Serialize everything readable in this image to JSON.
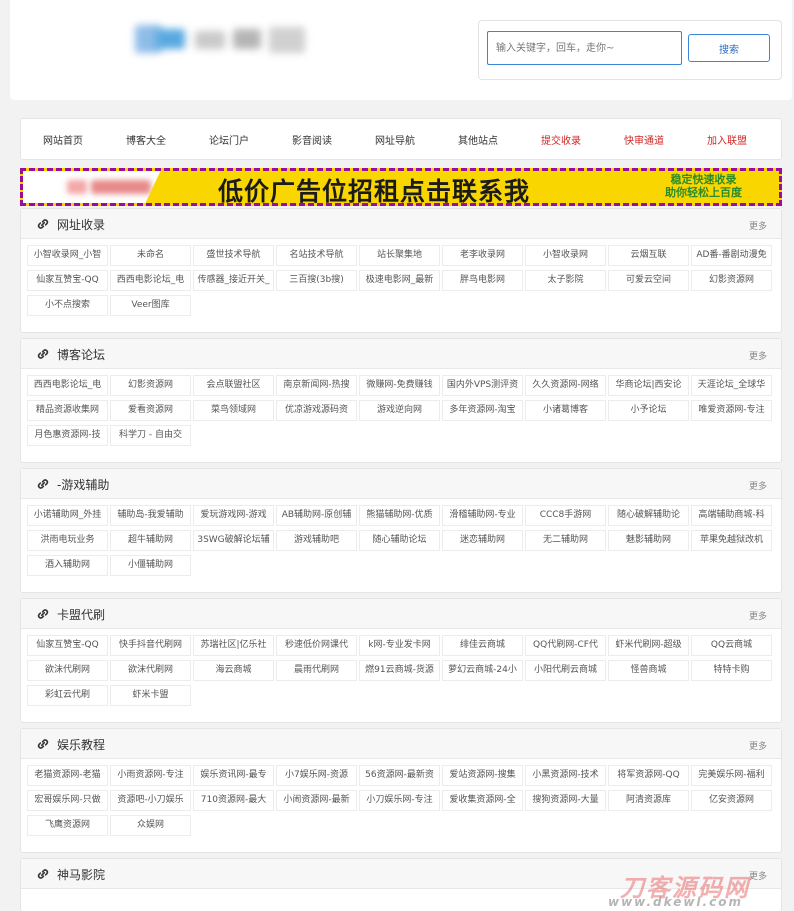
{
  "search": {
    "placeholder": "输入关键字，回车，走你~",
    "button_label": "搜索"
  },
  "nav": {
    "items": [
      {
        "label": "网站首页",
        "red": false
      },
      {
        "label": "博客大全",
        "red": false
      },
      {
        "label": "论坛门户",
        "red": false
      },
      {
        "label": "影音阅读",
        "red": false
      },
      {
        "label": "网址导航",
        "red": false
      },
      {
        "label": "其他站点",
        "red": false
      },
      {
        "label": "提交收录",
        "red": true
      },
      {
        "label": "快审通道",
        "red": true
      },
      {
        "label": "加入联盟",
        "red": true
      }
    ]
  },
  "banner": {
    "main_text": "低价广告位招租点击联系我",
    "side_line1": "稳定快速收录",
    "side_line2": "助你轻松上百度"
  },
  "colors": {
    "nav_red": "#d02525",
    "accent_blue": "#3a86d6",
    "banner_yellow": "#fad600",
    "banner_border": "#9c0c9c"
  },
  "sections": [
    {
      "title": "网址收录",
      "more": "更多",
      "items": [
        "小智收录网_小智",
        "未命名",
        "盛世技术导航",
        "名站技术导航",
        "站长聚集地",
        "老李收录网",
        "小智收录网",
        "云烟互联",
        "AD番-番剧动漫免",
        "仙家互赞宝-QQ",
        "西西电影论坛_电",
        "传感器_接近开关_",
        "三百搜(3b搜)",
        "极速电影网_最新",
        "胖鸟电影网",
        "太子影院",
        "可爱云空间",
        "幻影资源网",
        "小不点搜索",
        "Veer图库"
      ]
    },
    {
      "title": "博客论坛",
      "more": "更多",
      "items": [
        "西西电影论坛_电",
        "幻影资源网",
        "会点联盟社区",
        "南京新闻网-热搜",
        "微赚网-免费赚钱",
        "国内外VPS测评资",
        "久久资源网-网络",
        "华商论坛|西安论",
        "天涯论坛_全球华",
        "精品资源收集网",
        "爱看资源网",
        "菜鸟领域网",
        "优凉游戏源码资",
        "游戏逆向网",
        "多年资源网-淘宝",
        "小诸葛博客",
        "小予论坛",
        "唯爱资源网-专注",
        "月色惠资源网-技",
        "科学刀 - 自由交"
      ]
    },
    {
      "title": "-游戏辅助",
      "more": "更多",
      "items": [
        "小诺辅助网_外挂",
        "辅助岛-我爱辅助",
        "爱玩游戏网-游戏",
        "AB辅助网-原创辅",
        "熊猫辅助网-优质",
        "滑稽辅助网-专业",
        "CCC8手游网",
        "随心破解辅助论",
        "高端辅助商城-科",
        "洪雨电玩业务",
        "超牛辅助网",
        "3SWG破解论坛辅",
        "游戏辅助吧",
        "随心辅助论坛",
        "迷恋辅助网",
        "无二辅助网",
        "魅影辅助网",
        "苹果免越狱改机",
        "酒入辅助网",
        "小僵辅助网"
      ]
    },
    {
      "title": "卡盟代刷",
      "more": "更多",
      "items": [
        "仙家互赞宝-QQ",
        "快手抖音代刷网",
        "苏瑞社区|亿乐社",
        "秒速低价网课代",
        "k网-专业发卡网",
        "绯佳云商城",
        "QQ代刷网-CF代",
        "虾米代刷网-超级",
        "QQ云商城",
        "欲沫代刷网",
        "欲沫代刷网",
        "海云商城",
        "晨雨代刷网",
        "燃91云商城-货源",
        "萝幻云商城-24小",
        "小阳代刷云商城",
        "怪兽商城",
        "特特卡购",
        "彩虹云代刷",
        "虾米卡盟"
      ]
    },
    {
      "title": "娱乐教程",
      "more": "更多",
      "items": [
        "老猫资源网-老猫",
        "小雨资源网-专注",
        "娱乐资讯网-最专",
        "小7娱乐网-资源",
        "56资源网-最新资",
        "爱站资源网-搜集",
        "小黑资源网-技术",
        "将军资源网-QQ",
        "完美娱乐网-福利",
        "宏哥娱乐网-只做",
        "资源吧-小刀娱乐",
        "710资源网-最大",
        "小闹资源网-最新",
        "小刀娱乐网-专注",
        "爱收集资源网-全",
        "搜狗资源网-大量",
        "阿清资源库",
        "亿安资源网",
        "飞鹰资源网",
        "众娱网"
      ]
    },
    {
      "title": "神马影院",
      "more": "更多",
      "items": []
    }
  ],
  "watermark": {
    "line1": "刀客源码网",
    "line2": "www.dkewl.com"
  }
}
